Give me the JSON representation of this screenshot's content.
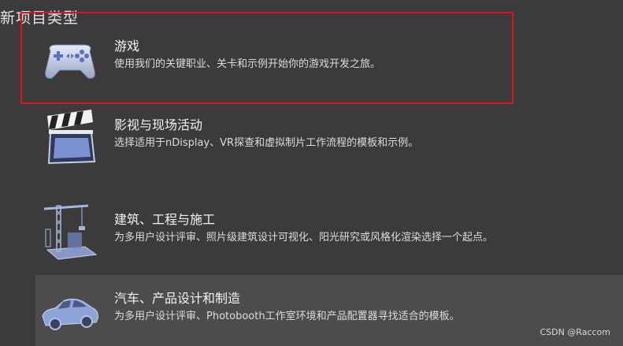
{
  "section_title": "新项目类型",
  "categories": [
    {
      "title": "游戏",
      "description": "使用我们的关键职业、关卡和示例开始你的游戏开发之旅。",
      "icon": "gamepad-icon"
    },
    {
      "title": "影视与现场活动",
      "description": "选择适用于nDisplay、VR探查和虚拟制片工作流程的模板和示例。",
      "icon": "clapperboard-icon"
    },
    {
      "title": "建筑、工程与施工",
      "description": "为多用户设计评审、照片级建筑设计可视化、阳光研究或风格化渲染选择一个起点。",
      "icon": "construction-crane-icon"
    },
    {
      "title": "汽车、产品设计和制造",
      "description": "为多用户设计评审、Photobooth工作室环境和产品配置器寻找适合的模板。",
      "icon": "car-icon"
    }
  ],
  "watermark": "CSDN @Raccom",
  "colors": {
    "background": "#3b3b3b",
    "highlight_border": "#e0141e",
    "icon_blue": "#8a9fd4"
  }
}
